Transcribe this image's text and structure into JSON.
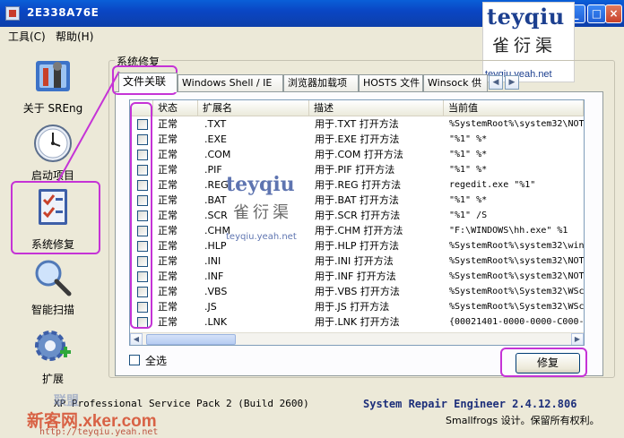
{
  "window": {
    "title": "2E338A76E"
  },
  "watermark": {
    "brand": "teyqiu",
    "chinese": "雀衍渠",
    "url": "teyqiu.yeah.net"
  },
  "menu": {
    "items": [
      "工具(C)",
      "帮助(H)"
    ]
  },
  "sidebar": {
    "items": [
      {
        "label": "关于 SREng",
        "icon": "tools-icon"
      },
      {
        "label": "启动项目",
        "icon": "clock-icon"
      },
      {
        "label": "系统修复",
        "icon": "checklist-icon",
        "selected": true
      },
      {
        "label": "智能扫描",
        "icon": "magnifier-icon"
      },
      {
        "label": "扩展",
        "icon": "gear-plus-icon"
      }
    ]
  },
  "group": {
    "title": "系统修复"
  },
  "tabs": [
    "文件关联",
    "Windows Shell / IE",
    "浏览器加载项",
    "HOSTS 文件",
    "Winsock 供"
  ],
  "table": {
    "columns": [
      "状态",
      "扩展名",
      "描述",
      "当前值"
    ],
    "rows": [
      [
        "正常",
        ".TXT",
        "用于.TXT 打开方法",
        "%SystemRoot%\\system32\\NOT"
      ],
      [
        "正常",
        ".EXE",
        "用于.EXE 打开方法",
        "\"%1\" %*"
      ],
      [
        "正常",
        ".COM",
        "用于.COM 打开方法",
        "\"%1\" %*"
      ],
      [
        "正常",
        ".PIF",
        "用于.PIF 打开方法",
        "\"%1\" %*"
      ],
      [
        "正常",
        ".REG",
        "用于.REG 打开方法",
        "regedit.exe \"%1\""
      ],
      [
        "正常",
        ".BAT",
        "用于.BAT 打开方法",
        "\"%1\" %*"
      ],
      [
        "正常",
        ".SCR",
        "用于.SCR 打开方法",
        "\"%1\" /S"
      ],
      [
        "正常",
        ".CHM",
        "用于.CHM 打开方法",
        "\"F:\\WINDOWS\\hh.exe\" %1"
      ],
      [
        "正常",
        ".HLP",
        "用于.HLP 打开方法",
        "%SystemRoot%\\system32\\win"
      ],
      [
        "正常",
        ".INI",
        "用于.INI 打开方法",
        "%SystemRoot%\\system32\\NOT"
      ],
      [
        "正常",
        ".INF",
        "用于.INF 打开方法",
        "%SystemRoot%\\system32\\NOT"
      ],
      [
        "正常",
        ".VBS",
        "用于.VBS 打开方法",
        "%SystemRoot%\\System32\\WSc"
      ],
      [
        "正常",
        ".JS",
        "用于.JS 打开方法",
        "%SystemRoot%\\System32\\WSc"
      ],
      [
        "正常",
        ".LNK",
        "用于.LNK 打开方法",
        "{00021401-0000-0000-C000-"
      ]
    ]
  },
  "select_all": {
    "label": "全选"
  },
  "repair_button": {
    "label": "修复"
  },
  "status": {
    "os": "XP Professional Service Pack 2 (Build 2600)",
    "product": "System Repair Engineer 2.4.12.806",
    "copyright": "Smallfrogs 设计。保留所有权利。"
  },
  "bottom_watermark": {
    "site": "新客网.xker.com",
    "url": "http://teyqiu.yeah.net",
    "union": "联盟"
  },
  "colors": {
    "highlight": "#c533d6",
    "title_bar": "#0a46c4",
    "product_text": "#1d2f7a"
  }
}
